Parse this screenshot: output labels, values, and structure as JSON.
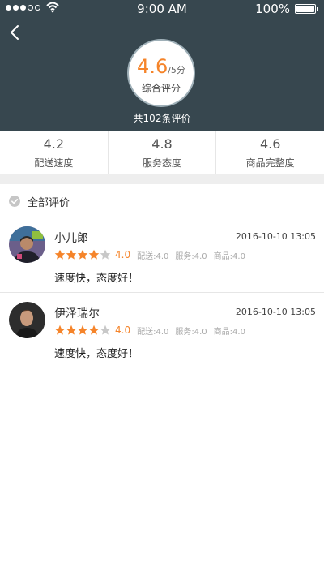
{
  "status_bar": {
    "time": "9:00 AM",
    "battery": "100%"
  },
  "header": {
    "score": "4.6",
    "score_unit": "/5分",
    "score_label": "综合评分",
    "total": "共102条评价"
  },
  "stats": [
    {
      "value": "4.2",
      "label": "配送速度"
    },
    {
      "value": "4.8",
      "label": "服务态度"
    },
    {
      "value": "4.6",
      "label": "商品完整度"
    }
  ],
  "section": {
    "title": "全部评价"
  },
  "reviews": [
    {
      "name": "小儿郎",
      "time": "2016-10-10 13:05",
      "stars": 4,
      "score": "4.0",
      "delivery": "配送:4.0",
      "service": "服务:4.0",
      "goods": "商品:4.0",
      "text": "速度快，态度好！"
    },
    {
      "name": "伊泽瑞尔",
      "time": "2016-10-10 13:05",
      "stars": 4,
      "score": "4.0",
      "delivery": "配送:4.0",
      "service": "服务:4.0",
      "goods": "商品:4.0",
      "text": "速度快，态度好！"
    }
  ],
  "colors": {
    "header_bg": "#37474f",
    "accent": "#f5842a",
    "star_off": "#c8c8c8"
  }
}
